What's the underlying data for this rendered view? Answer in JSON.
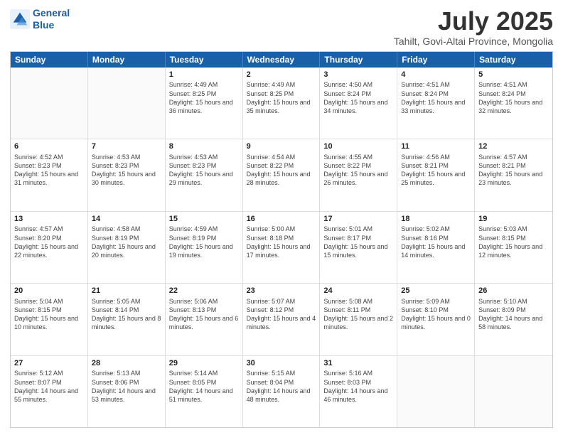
{
  "header": {
    "logo_line1": "General",
    "logo_line2": "Blue",
    "title": "July 2025",
    "subtitle": "Tahilt, Govi-Altai Province, Mongolia"
  },
  "days_of_week": [
    "Sunday",
    "Monday",
    "Tuesday",
    "Wednesday",
    "Thursday",
    "Friday",
    "Saturday"
  ],
  "rows": [
    [
      {
        "day": "",
        "sunrise": "",
        "sunset": "",
        "daylight": ""
      },
      {
        "day": "",
        "sunrise": "",
        "sunset": "",
        "daylight": ""
      },
      {
        "day": "1",
        "sunrise": "Sunrise: 4:49 AM",
        "sunset": "Sunset: 8:25 PM",
        "daylight": "Daylight: 15 hours and 36 minutes."
      },
      {
        "day": "2",
        "sunrise": "Sunrise: 4:49 AM",
        "sunset": "Sunset: 8:25 PM",
        "daylight": "Daylight: 15 hours and 35 minutes."
      },
      {
        "day": "3",
        "sunrise": "Sunrise: 4:50 AM",
        "sunset": "Sunset: 8:24 PM",
        "daylight": "Daylight: 15 hours and 34 minutes."
      },
      {
        "day": "4",
        "sunrise": "Sunrise: 4:51 AM",
        "sunset": "Sunset: 8:24 PM",
        "daylight": "Daylight: 15 hours and 33 minutes."
      },
      {
        "day": "5",
        "sunrise": "Sunrise: 4:51 AM",
        "sunset": "Sunset: 8:24 PM",
        "daylight": "Daylight: 15 hours and 32 minutes."
      }
    ],
    [
      {
        "day": "6",
        "sunrise": "Sunrise: 4:52 AM",
        "sunset": "Sunset: 8:23 PM",
        "daylight": "Daylight: 15 hours and 31 minutes."
      },
      {
        "day": "7",
        "sunrise": "Sunrise: 4:53 AM",
        "sunset": "Sunset: 8:23 PM",
        "daylight": "Daylight: 15 hours and 30 minutes."
      },
      {
        "day": "8",
        "sunrise": "Sunrise: 4:53 AM",
        "sunset": "Sunset: 8:23 PM",
        "daylight": "Daylight: 15 hours and 29 minutes."
      },
      {
        "day": "9",
        "sunrise": "Sunrise: 4:54 AM",
        "sunset": "Sunset: 8:22 PM",
        "daylight": "Daylight: 15 hours and 28 minutes."
      },
      {
        "day": "10",
        "sunrise": "Sunrise: 4:55 AM",
        "sunset": "Sunset: 8:22 PM",
        "daylight": "Daylight: 15 hours and 26 minutes."
      },
      {
        "day": "11",
        "sunrise": "Sunrise: 4:56 AM",
        "sunset": "Sunset: 8:21 PM",
        "daylight": "Daylight: 15 hours and 25 minutes."
      },
      {
        "day": "12",
        "sunrise": "Sunrise: 4:57 AM",
        "sunset": "Sunset: 8:21 PM",
        "daylight": "Daylight: 15 hours and 23 minutes."
      }
    ],
    [
      {
        "day": "13",
        "sunrise": "Sunrise: 4:57 AM",
        "sunset": "Sunset: 8:20 PM",
        "daylight": "Daylight: 15 hours and 22 minutes."
      },
      {
        "day": "14",
        "sunrise": "Sunrise: 4:58 AM",
        "sunset": "Sunset: 8:19 PM",
        "daylight": "Daylight: 15 hours and 20 minutes."
      },
      {
        "day": "15",
        "sunrise": "Sunrise: 4:59 AM",
        "sunset": "Sunset: 8:19 PM",
        "daylight": "Daylight: 15 hours and 19 minutes."
      },
      {
        "day": "16",
        "sunrise": "Sunrise: 5:00 AM",
        "sunset": "Sunset: 8:18 PM",
        "daylight": "Daylight: 15 hours and 17 minutes."
      },
      {
        "day": "17",
        "sunrise": "Sunrise: 5:01 AM",
        "sunset": "Sunset: 8:17 PM",
        "daylight": "Daylight: 15 hours and 15 minutes."
      },
      {
        "day": "18",
        "sunrise": "Sunrise: 5:02 AM",
        "sunset": "Sunset: 8:16 PM",
        "daylight": "Daylight: 15 hours and 14 minutes."
      },
      {
        "day": "19",
        "sunrise": "Sunrise: 5:03 AM",
        "sunset": "Sunset: 8:15 PM",
        "daylight": "Daylight: 15 hours and 12 minutes."
      }
    ],
    [
      {
        "day": "20",
        "sunrise": "Sunrise: 5:04 AM",
        "sunset": "Sunset: 8:15 PM",
        "daylight": "Daylight: 15 hours and 10 minutes."
      },
      {
        "day": "21",
        "sunrise": "Sunrise: 5:05 AM",
        "sunset": "Sunset: 8:14 PM",
        "daylight": "Daylight: 15 hours and 8 minutes."
      },
      {
        "day": "22",
        "sunrise": "Sunrise: 5:06 AM",
        "sunset": "Sunset: 8:13 PM",
        "daylight": "Daylight: 15 hours and 6 minutes."
      },
      {
        "day": "23",
        "sunrise": "Sunrise: 5:07 AM",
        "sunset": "Sunset: 8:12 PM",
        "daylight": "Daylight: 15 hours and 4 minutes."
      },
      {
        "day": "24",
        "sunrise": "Sunrise: 5:08 AM",
        "sunset": "Sunset: 8:11 PM",
        "daylight": "Daylight: 15 hours and 2 minutes."
      },
      {
        "day": "25",
        "sunrise": "Sunrise: 5:09 AM",
        "sunset": "Sunset: 8:10 PM",
        "daylight": "Daylight: 15 hours and 0 minutes."
      },
      {
        "day": "26",
        "sunrise": "Sunrise: 5:10 AM",
        "sunset": "Sunset: 8:09 PM",
        "daylight": "Daylight: 14 hours and 58 minutes."
      }
    ],
    [
      {
        "day": "27",
        "sunrise": "Sunrise: 5:12 AM",
        "sunset": "Sunset: 8:07 PM",
        "daylight": "Daylight: 14 hours and 55 minutes."
      },
      {
        "day": "28",
        "sunrise": "Sunrise: 5:13 AM",
        "sunset": "Sunset: 8:06 PM",
        "daylight": "Daylight: 14 hours and 53 minutes."
      },
      {
        "day": "29",
        "sunrise": "Sunrise: 5:14 AM",
        "sunset": "Sunset: 8:05 PM",
        "daylight": "Daylight: 14 hours and 51 minutes."
      },
      {
        "day": "30",
        "sunrise": "Sunrise: 5:15 AM",
        "sunset": "Sunset: 8:04 PM",
        "daylight": "Daylight: 14 hours and 48 minutes."
      },
      {
        "day": "31",
        "sunrise": "Sunrise: 5:16 AM",
        "sunset": "Sunset: 8:03 PM",
        "daylight": "Daylight: 14 hours and 46 minutes."
      },
      {
        "day": "",
        "sunrise": "",
        "sunset": "",
        "daylight": ""
      },
      {
        "day": "",
        "sunrise": "",
        "sunset": "",
        "daylight": ""
      }
    ]
  ]
}
